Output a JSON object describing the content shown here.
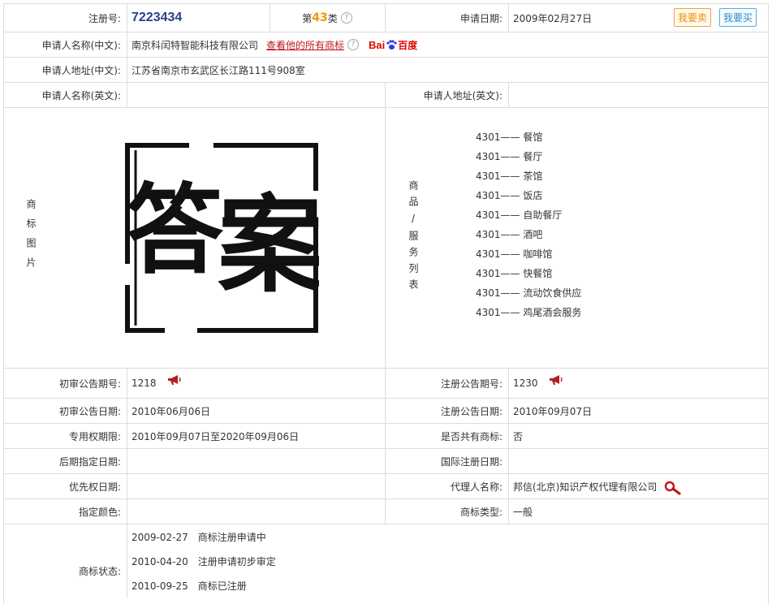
{
  "header": {
    "reg_no_label": "注册号:",
    "reg_no": "7223434",
    "class_prefix": "第",
    "class_num": "43",
    "class_suffix": "类",
    "apply_date_label": "申请日期:",
    "apply_date": "2009年02月27日",
    "sell_button": "我要卖",
    "buy_button": "我要买"
  },
  "applicant": {
    "name_cn_label": "申请人名称(中文):",
    "name_cn": "南京科闰特智能科技有限公司",
    "view_all_link": "查看他的所有商标",
    "baidu_bai": "Bai",
    "baidu_du": "百度",
    "addr_cn_label": "申请人地址(中文):",
    "addr_cn": "江苏省南京市玄武区长江路111号908室",
    "name_en_label": "申请人名称(英文):",
    "name_en": "",
    "addr_en_label": "申请人地址(英文):",
    "addr_en": ""
  },
  "image_section": {
    "label": "商标图片",
    "logo_text_left": "答",
    "logo_text_right": "案"
  },
  "goods_section": {
    "label": "商品/服务列表",
    "items": [
      {
        "code": "4301——",
        "name": "餐馆"
      },
      {
        "code": "4301——",
        "name": "餐厅"
      },
      {
        "code": "4301——",
        "name": "茶馆"
      },
      {
        "code": "4301——",
        "name": "饭店"
      },
      {
        "code": "4301——",
        "name": "自助餐厅"
      },
      {
        "code": "4301——",
        "name": "酒吧"
      },
      {
        "code": "4301——",
        "name": "咖啡馆"
      },
      {
        "code": "4301——",
        "name": "快餐馆"
      },
      {
        "code": "4301——",
        "name": "流动饮食供应"
      },
      {
        "code": "4301——",
        "name": "鸡尾酒会服务"
      }
    ]
  },
  "details": {
    "prelim_no_label": "初审公告期号:",
    "prelim_no": "1218",
    "reg_pub_no_label": "注册公告期号:",
    "reg_pub_no": "1230",
    "prelim_date_label": "初审公告日期:",
    "prelim_date": "2010年06月06日",
    "reg_pub_date_label": "注册公告日期:",
    "reg_pub_date": "2010年09月07日",
    "exclusive_label": "专用权期限:",
    "exclusive": "2010年09月07日至2020年09月06日",
    "shared_label": "是否共有商标:",
    "shared": "否",
    "later_label": "后期指定日期:",
    "later": "",
    "intl_label": "国际注册日期:",
    "intl": "",
    "priority_label": "优先权日期:",
    "priority": "",
    "agent_label": "代理人名称:",
    "agent": "邦信(北京)知识产权代理有限公司",
    "color_label": "指定颜色:",
    "color": "",
    "type_label": "商标类型:",
    "type": "一般"
  },
  "status": {
    "label": "商标状态:",
    "items": [
      {
        "date": "2009-02-27",
        "text": "商标注册申请中"
      },
      {
        "date": "2010-04-20",
        "text": "注册申请初步审定"
      },
      {
        "date": "2010-09-25",
        "text": "商标已注册"
      }
    ]
  }
}
